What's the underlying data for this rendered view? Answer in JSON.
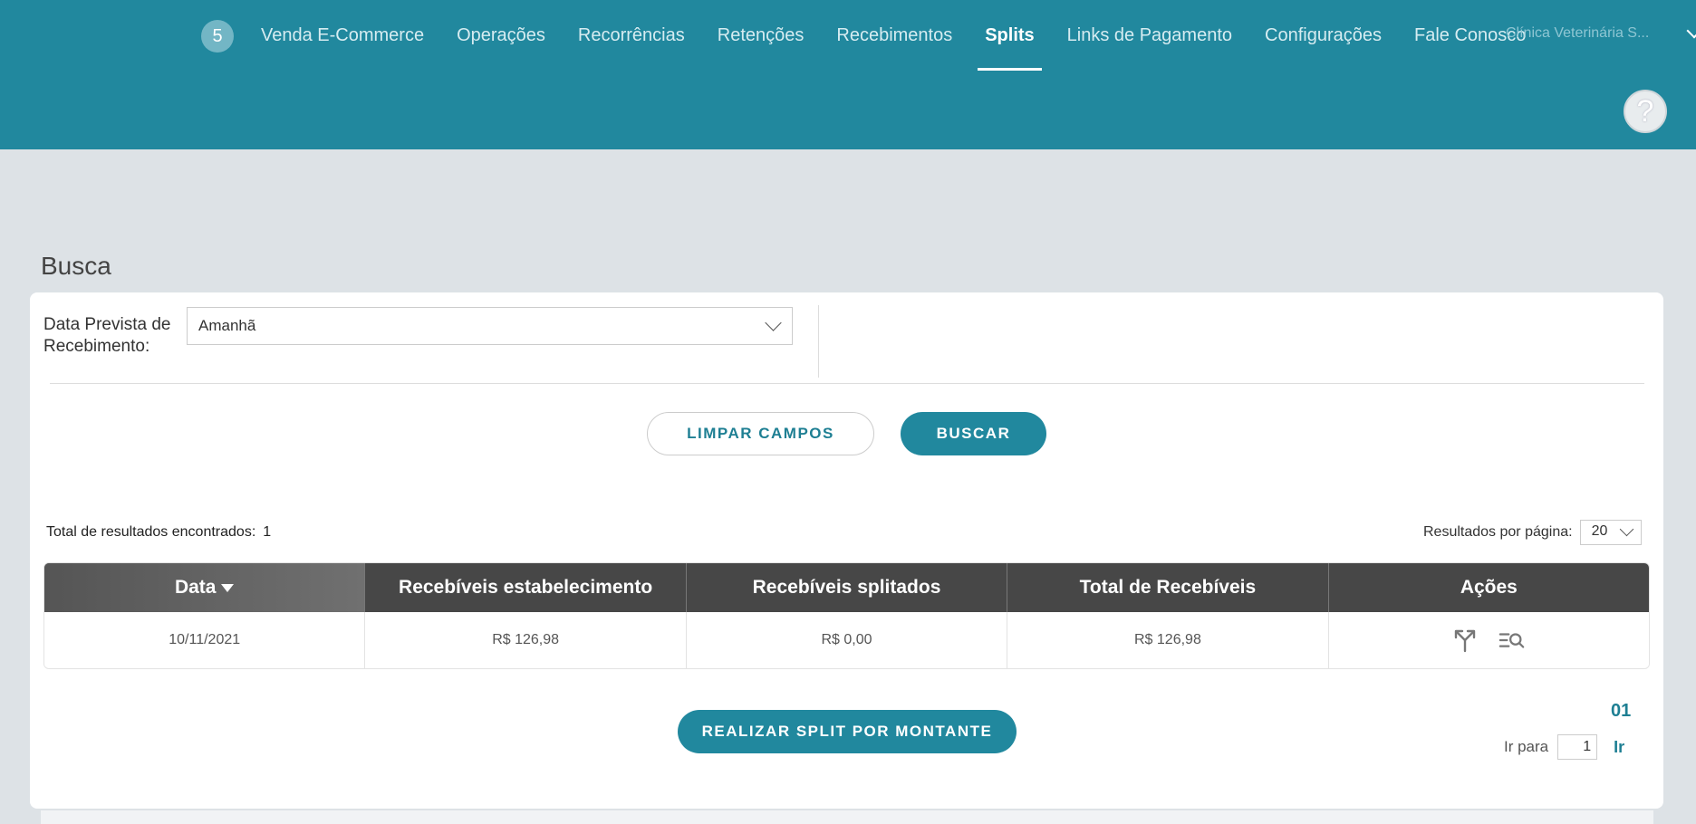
{
  "colors": {
    "primary": "#21889e",
    "header_dark": "#474747",
    "background": "#dde2e6"
  },
  "header": {
    "badge_count": "5",
    "nav": [
      {
        "label": "Venda E-Commerce"
      },
      {
        "label": "Operações"
      },
      {
        "label": "Recorrências"
      },
      {
        "label": "Retenções"
      },
      {
        "label": "Recebimentos"
      },
      {
        "label": "Splits",
        "active": true
      },
      {
        "label": "Links de Pagamento"
      },
      {
        "label": "Configurações"
      },
      {
        "label": "Fale Conosco"
      }
    ],
    "user_name": "Clínica Veterinária S...",
    "help_icon": "question-icon"
  },
  "search": {
    "title": "Busca",
    "filter_label": "Data Prevista de Recebimento:",
    "filter_value": "Amanhã",
    "clear_label": "LIMPAR CAMPOS",
    "search_label": "BUSCAR"
  },
  "results": {
    "total_label": "Total de resultados encontrados:",
    "total_count": "1",
    "per_page_label": "Resultados por página:",
    "per_page_value": "20",
    "columns": [
      "Data",
      "Recebíveis estabelecimento",
      "Recebíveis splitados",
      "Total de Recebíveis",
      "Ações"
    ],
    "rows": [
      {
        "data": "10/11/2021",
        "estabelecimento": "R$ 126,98",
        "splitados": "R$ 0,00",
        "total": "R$ 126,98"
      }
    ],
    "action_icons": [
      "split-icon",
      "search-list-icon"
    ]
  },
  "footer": {
    "split_button": "REALIZAR SPLIT POR MONTANTE",
    "page_number": "01",
    "goto_label": "Ir para",
    "goto_value": "1",
    "go_label": "Ir"
  }
}
